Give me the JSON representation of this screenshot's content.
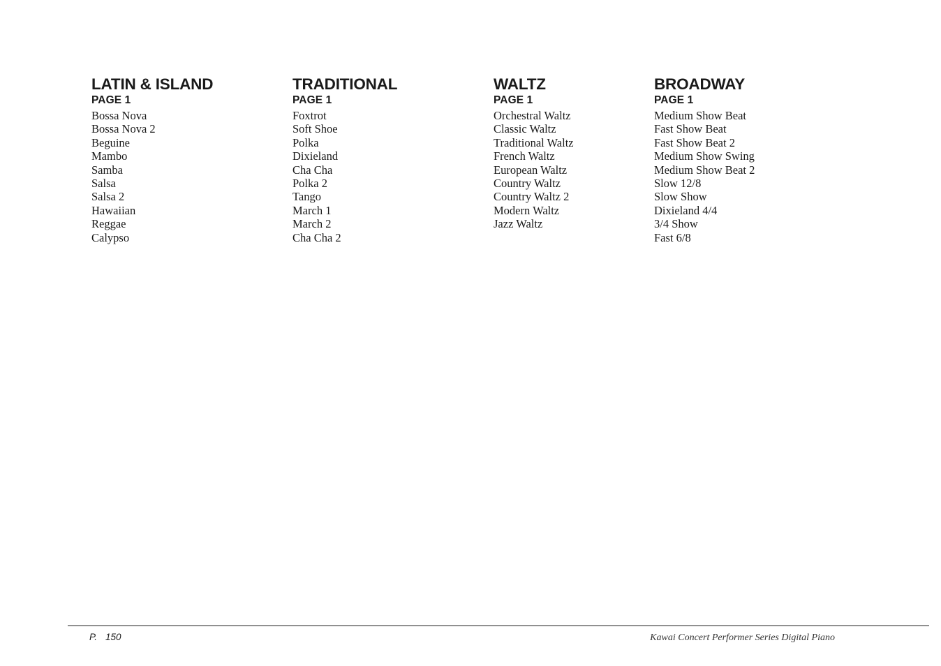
{
  "page": {
    "background_color": "#ffffff",
    "text_color": "#1a1a1a"
  },
  "columns": [
    {
      "title": "LATIN & ISLAND",
      "page_label": "PAGE 1",
      "items": [
        "Bossa Nova",
        "Bossa Nova 2",
        "Beguine",
        "Mambo",
        "Samba",
        "Salsa",
        "Salsa 2",
        "Hawaiian",
        "Reggae",
        "Calypso"
      ]
    },
    {
      "title": "TRADITIONAL",
      "page_label": "PAGE 1",
      "items": [
        "Foxtrot",
        "Soft Shoe",
        "Polka",
        "Dixieland",
        "Cha Cha",
        "Polka 2",
        "Tango",
        "March 1",
        "March 2",
        "Cha Cha 2"
      ]
    },
    {
      "title": "WALTZ",
      "page_label": "PAGE 1",
      "items": [
        "Orchestral Waltz",
        "Classic Waltz",
        "Traditional Waltz",
        "French Waltz",
        "European Waltz",
        "Country Waltz",
        "Country Waltz 2",
        "Modern Waltz",
        "Jazz Waltz"
      ]
    },
    {
      "title": "BROADWAY",
      "page_label": "PAGE 1",
      "items": [
        "Medium Show Beat",
        "Fast Show Beat",
        "Fast Show Beat 2",
        "Medium Show Swing",
        "Medium Show Beat 2",
        "Slow 12/8",
        "Slow Show",
        "Dixieland 4/4",
        "3/4 Show",
        "Fast 6/8"
      ]
    }
  ],
  "footer": {
    "page_prefix": "P.",
    "page_number": "150",
    "product_line": "Kawai Concert Performer Series Digital Piano"
  }
}
